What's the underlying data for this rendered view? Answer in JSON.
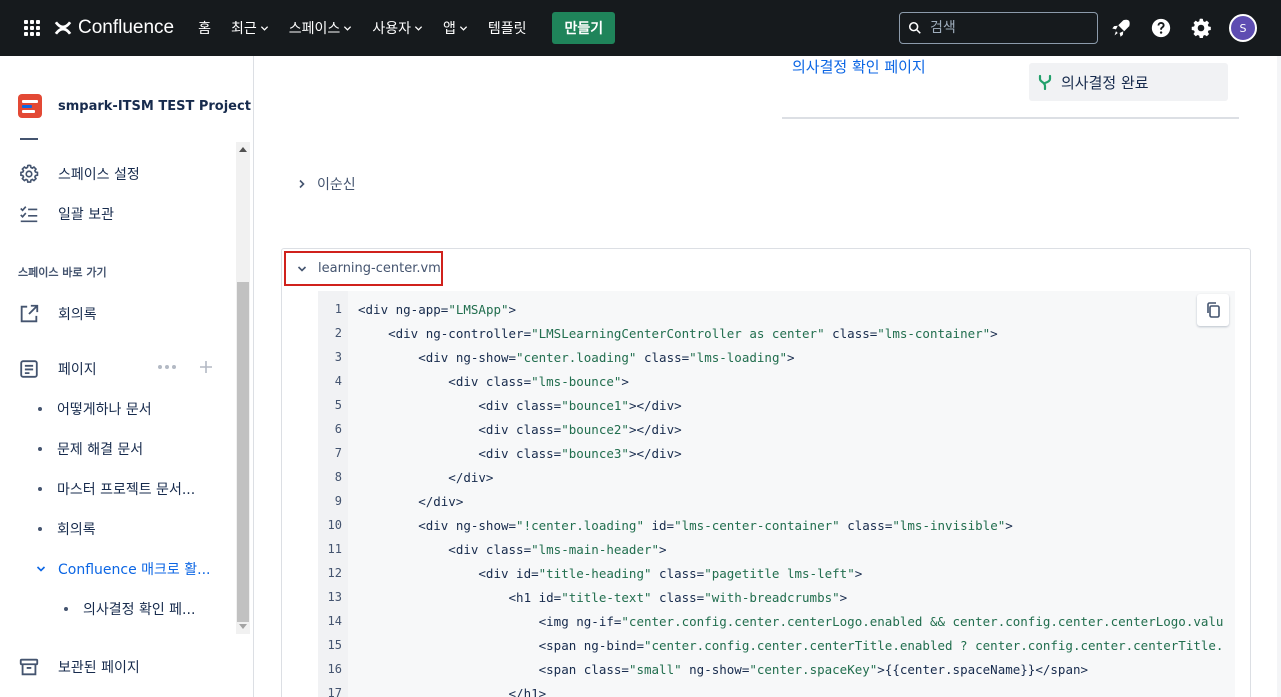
{
  "topnav": {
    "brand": "Confluence",
    "items": [
      {
        "label": "홈",
        "dropdown": false
      },
      {
        "label": "최근",
        "dropdown": true
      },
      {
        "label": "스페이스",
        "dropdown": true
      },
      {
        "label": "사용자",
        "dropdown": true
      },
      {
        "label": "앱",
        "dropdown": true
      },
      {
        "label": "템플릿",
        "dropdown": false
      }
    ],
    "create_label": "만들기",
    "search_placeholder": "검색",
    "avatar_initial": "S"
  },
  "sidebar": {
    "space_name": "smpark-ITSM TEST Project",
    "settings_label": "스페이스 설정",
    "archive_label": "일괄 보관",
    "shortcuts_title": "스페이스 바로 가기",
    "meeting_label": "회의록",
    "pages_label": "페이지",
    "pages": [
      "어떻게하나 문서",
      "문제 해결 문서",
      "마스터 프로젝트 문서...",
      "회의록",
      "Confluence 매크로 활..."
    ],
    "subpage": "의사결정 확인 페...",
    "archived_pages_label": "보관된 페이지"
  },
  "main": {
    "link_text": "의사결정 확인 페이지",
    "decision_text": "의사결정 완료",
    "expander_label": "이순신",
    "code_title": "learning-center.vm",
    "code_lines": [
      "<div ng-app=\"LMSApp\">",
      "    <div ng-controller=\"LMSLearningCenterController as center\" class=\"lms-container\">",
      "        <div ng-show=\"center.loading\" class=\"lms-loading\">",
      "            <div class=\"lms-bounce\">",
      "                <div class=\"bounce1\"></div>",
      "                <div class=\"bounce2\"></div>",
      "                <div class=\"bounce3\"></div>",
      "            </div>",
      "        </div>",
      "        <div ng-show=\"!center.loading\" id=\"lms-center-container\" class=\"lms-invisible\">",
      "            <div class=\"lms-main-header\">",
      "                <div id=\"title-heading\" class=\"pagetitle lms-left\">",
      "                    <h1 id=\"title-text\" class=\"with-breadcrumbs\">",
      "                        <img ng-if=\"center.config.center.centerLogo.enabled && center.config.center.centerLogo.valu",
      "                        <span ng-bind=\"center.config.center.centerTitle.enabled ? center.config.center.centerTitle.",
      "                        <span class=\"small\" ng-show=\"center.spaceKey\">{{center.spaceName}}</span>",
      "                    </h1>"
    ]
  },
  "colors": {
    "topnav_bg": "#161a1d",
    "create_btn": "#1f845a",
    "link": "#0c66e4",
    "highlight_border": "#d0211c",
    "string": "#216e4e"
  }
}
